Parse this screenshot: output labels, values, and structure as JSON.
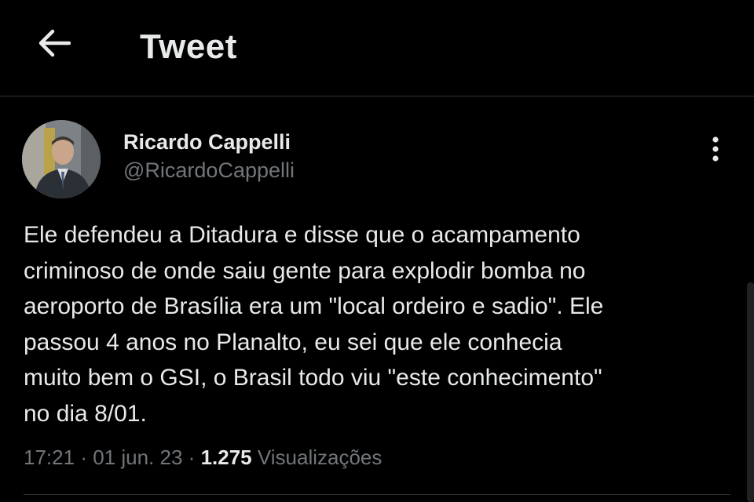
{
  "header": {
    "title": "Tweet",
    "back_icon": "arrow-left-icon"
  },
  "author": {
    "name": "Ricardo Cappelli",
    "handle": "@RicardoCappelli",
    "avatar_icon": "avatar-photo"
  },
  "more_icon": "more-vertical-icon",
  "tweet": {
    "text": "Ele defendeu a Ditadura e disse que o acampamento\ncriminoso de onde saiu gente para explodir bomba no\naeroporto de Brasília era um \"local ordeiro e sadio\". Ele\npassou 4 anos no Planalto, eu sei que ele conhecia\nmuito bem o GSI, o Brasil todo viu \"este conhecimento\"\nno dia 8/01."
  },
  "meta": {
    "time": "17:21",
    "separator": "·",
    "date": "01 jun. 23",
    "views_count": "1.275",
    "views_label": "Visualizações"
  },
  "colors": {
    "background": "#000000",
    "text_primary": "#e7e9ea",
    "text_secondary": "#71767b",
    "divider": "#2f3336"
  }
}
